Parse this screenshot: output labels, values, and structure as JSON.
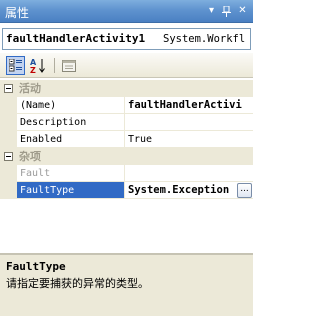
{
  "window": {
    "title": "属性",
    "dropdown_glyph": "▾",
    "pin_glyph": "ᵖ",
    "close_glyph": "✕"
  },
  "selector": {
    "object_name": "faultHandlerActivity1",
    "object_type": "System.Workfl"
  },
  "toolbar": {
    "categorized_icon": "categorized-view-icon",
    "alphabetical_icon": "alphabetical-sort-icon",
    "property_pages_icon": "property-pages-icon"
  },
  "grid": {
    "categories": [
      {
        "label": "活动",
        "properties": [
          {
            "name": "(Name)",
            "value": "faultHandlerActivi",
            "bold": true
          },
          {
            "name": "Description",
            "value": ""
          },
          {
            "name": "Enabled",
            "value": "True"
          }
        ]
      },
      {
        "label": "杂项",
        "properties": [
          {
            "name": "Fault",
            "value": "",
            "disabled": true
          },
          {
            "name": "FaultType",
            "value": "System.Exception",
            "bold": true,
            "selected": true,
            "button": "..."
          }
        ]
      }
    ]
  },
  "description": {
    "title": "FaultType",
    "text": "请指定要捕获的异常的类型。"
  },
  "colors": {
    "title_bar": "#5f93cf",
    "selection": "#316ac5",
    "category_bg": "#ece9d8"
  }
}
